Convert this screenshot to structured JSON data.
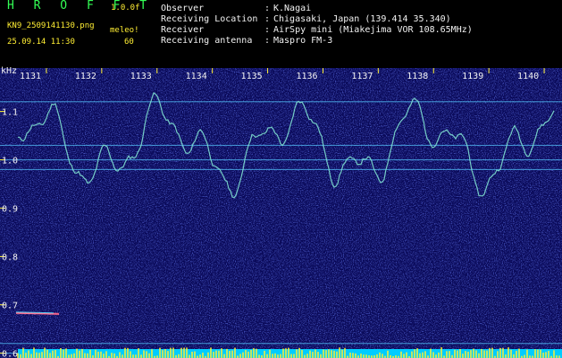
{
  "app": {
    "logo": "H R O F F T",
    "version": "1.0.0f",
    "filename": "KN9_2509141130.png",
    "timestamp": "25.09.14 11:30",
    "unit_label": "meleo!",
    "unit_value": "60"
  },
  "info": [
    {
      "label": "Observer",
      "value": "K.Nagai"
    },
    {
      "label": "Receiving Location",
      "value": "Chigasaki, Japan (139.414 35.340)"
    },
    {
      "label": "Receiver",
      "value": "AirSpy mini (Miakejima VOR 108.65MHz)"
    },
    {
      "label": "Receiving antenna",
      "value": "Maspro FM-3"
    }
  ],
  "colon": ":",
  "spectrogram": {
    "y_unit": "kHz",
    "y_range": [
      0.59,
      1.19
    ],
    "y_ticks": [
      "1.1",
      "1.0",
      "0.9",
      "0.8",
      "0.7",
      "0.6"
    ],
    "x_range": [
      1130.5,
      1140.5
    ],
    "x_ticks": [
      "1131",
      "1132",
      "1133",
      "1134",
      "1135",
      "1136",
      "1137",
      "1138",
      "1139",
      "1140"
    ],
    "horizontal_lines_khz": [
      1.12,
      1.03,
      1.0,
      0.98,
      0.62,
      0.6
    ],
    "colors": {
      "background": "#0a0a5a",
      "noise": "#2230c0",
      "trace": "#7fe0d0",
      "line": "#55c8ff",
      "bottom_band": "#00ccff",
      "bottom_spikes": "#ffee33",
      "ticks": "#ffee33"
    }
  }
}
